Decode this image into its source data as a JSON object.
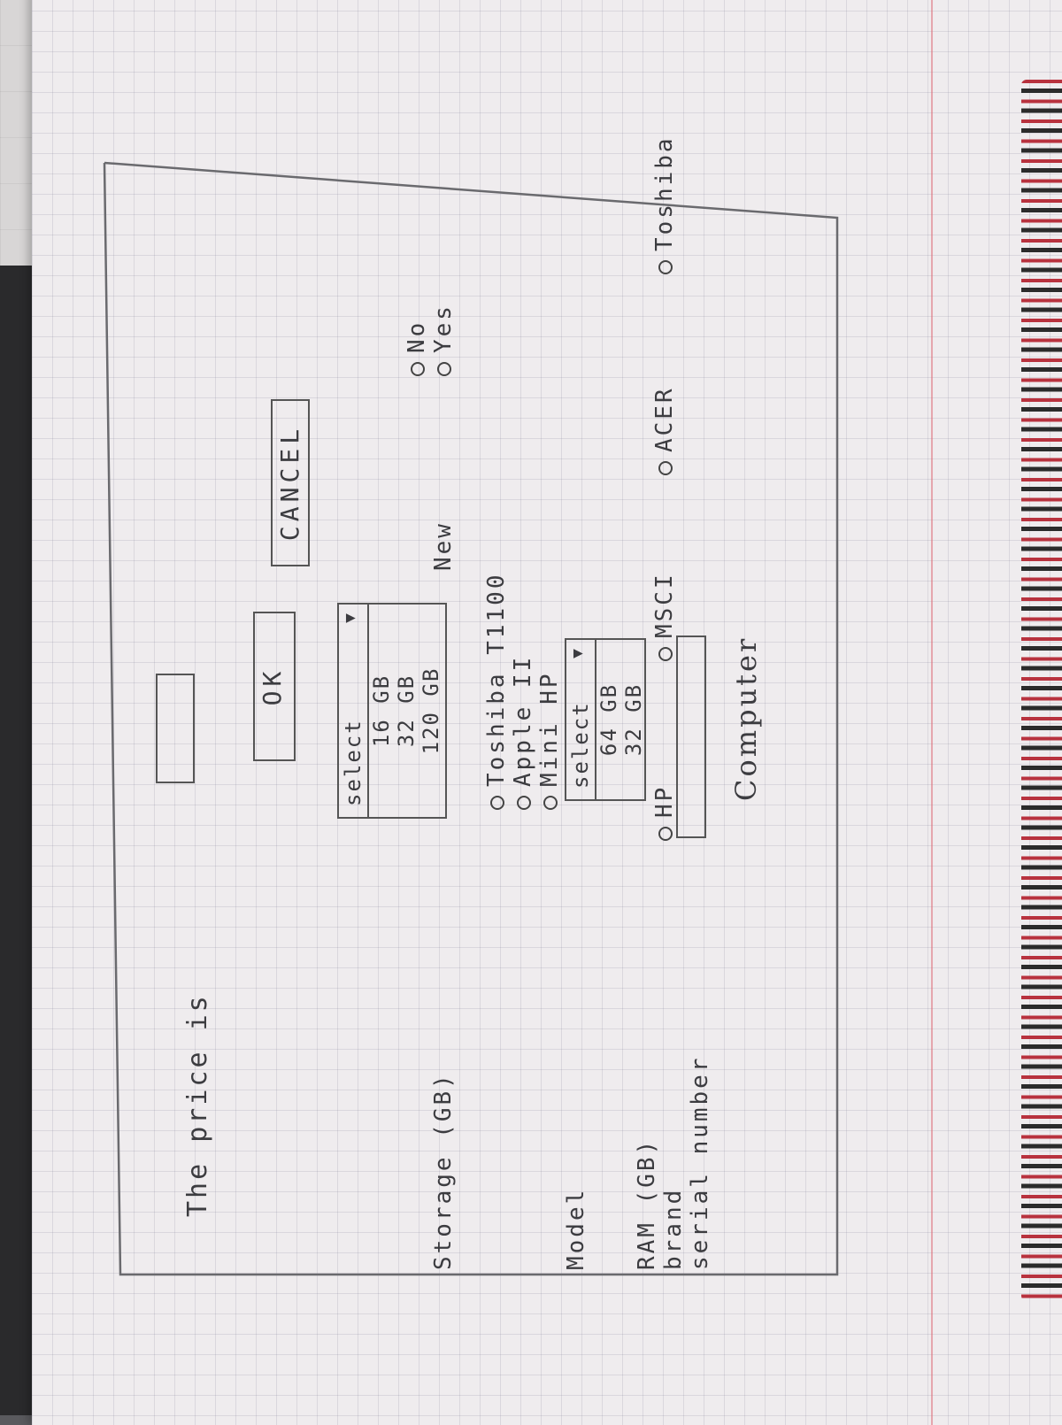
{
  "dialog": {
    "title": "Computer",
    "serial_label": "serial number",
    "brand_label": "brand",
    "brand_options": [
      "HP",
      "MSCI",
      "ACER",
      "Toshiba"
    ],
    "ram_label": "RAM (GB)",
    "ram_select": {
      "selected": "select",
      "options": [
        "64 GB",
        "32 GB"
      ]
    },
    "model_label": "Model",
    "model_options": [
      "Mini HP",
      "Apple II",
      "Toshiba T1100"
    ],
    "storage_label": "Storage (GB)",
    "storage_select": {
      "selected": "select",
      "options": [
        "16 GB",
        "32 GB",
        "120 GB"
      ]
    },
    "new_label": "New",
    "new_options": [
      "Yes",
      "No"
    ],
    "ok_label": "OK",
    "cancel_label": "CANCEL",
    "price_label": "The price is"
  }
}
